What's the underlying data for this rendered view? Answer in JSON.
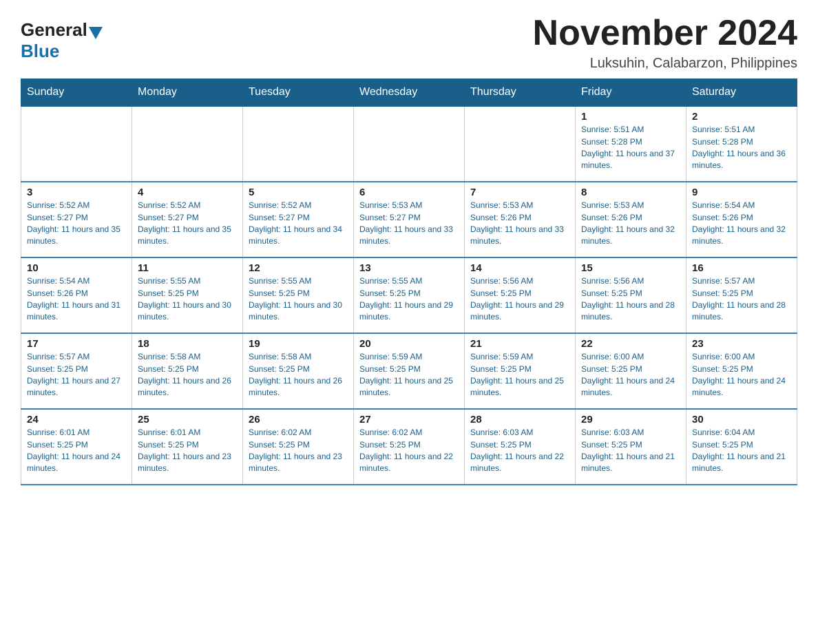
{
  "logo": {
    "general": "General",
    "blue": "Blue"
  },
  "title": {
    "month_year": "November 2024",
    "location": "Luksuhin, Calabarzon, Philippines"
  },
  "weekdays": [
    "Sunday",
    "Monday",
    "Tuesday",
    "Wednesday",
    "Thursday",
    "Friday",
    "Saturday"
  ],
  "weeks": [
    [
      {
        "day": "",
        "info": ""
      },
      {
        "day": "",
        "info": ""
      },
      {
        "day": "",
        "info": ""
      },
      {
        "day": "",
        "info": ""
      },
      {
        "day": "",
        "info": ""
      },
      {
        "day": "1",
        "info": "Sunrise: 5:51 AM\nSunset: 5:28 PM\nDaylight: 11 hours and 37 minutes."
      },
      {
        "day": "2",
        "info": "Sunrise: 5:51 AM\nSunset: 5:28 PM\nDaylight: 11 hours and 36 minutes."
      }
    ],
    [
      {
        "day": "3",
        "info": "Sunrise: 5:52 AM\nSunset: 5:27 PM\nDaylight: 11 hours and 35 minutes."
      },
      {
        "day": "4",
        "info": "Sunrise: 5:52 AM\nSunset: 5:27 PM\nDaylight: 11 hours and 35 minutes."
      },
      {
        "day": "5",
        "info": "Sunrise: 5:52 AM\nSunset: 5:27 PM\nDaylight: 11 hours and 34 minutes."
      },
      {
        "day": "6",
        "info": "Sunrise: 5:53 AM\nSunset: 5:27 PM\nDaylight: 11 hours and 33 minutes."
      },
      {
        "day": "7",
        "info": "Sunrise: 5:53 AM\nSunset: 5:26 PM\nDaylight: 11 hours and 33 minutes."
      },
      {
        "day": "8",
        "info": "Sunrise: 5:53 AM\nSunset: 5:26 PM\nDaylight: 11 hours and 32 minutes."
      },
      {
        "day": "9",
        "info": "Sunrise: 5:54 AM\nSunset: 5:26 PM\nDaylight: 11 hours and 32 minutes."
      }
    ],
    [
      {
        "day": "10",
        "info": "Sunrise: 5:54 AM\nSunset: 5:26 PM\nDaylight: 11 hours and 31 minutes."
      },
      {
        "day": "11",
        "info": "Sunrise: 5:55 AM\nSunset: 5:25 PM\nDaylight: 11 hours and 30 minutes."
      },
      {
        "day": "12",
        "info": "Sunrise: 5:55 AM\nSunset: 5:25 PM\nDaylight: 11 hours and 30 minutes."
      },
      {
        "day": "13",
        "info": "Sunrise: 5:55 AM\nSunset: 5:25 PM\nDaylight: 11 hours and 29 minutes."
      },
      {
        "day": "14",
        "info": "Sunrise: 5:56 AM\nSunset: 5:25 PM\nDaylight: 11 hours and 29 minutes."
      },
      {
        "day": "15",
        "info": "Sunrise: 5:56 AM\nSunset: 5:25 PM\nDaylight: 11 hours and 28 minutes."
      },
      {
        "day": "16",
        "info": "Sunrise: 5:57 AM\nSunset: 5:25 PM\nDaylight: 11 hours and 28 minutes."
      }
    ],
    [
      {
        "day": "17",
        "info": "Sunrise: 5:57 AM\nSunset: 5:25 PM\nDaylight: 11 hours and 27 minutes."
      },
      {
        "day": "18",
        "info": "Sunrise: 5:58 AM\nSunset: 5:25 PM\nDaylight: 11 hours and 26 minutes."
      },
      {
        "day": "19",
        "info": "Sunrise: 5:58 AM\nSunset: 5:25 PM\nDaylight: 11 hours and 26 minutes."
      },
      {
        "day": "20",
        "info": "Sunrise: 5:59 AM\nSunset: 5:25 PM\nDaylight: 11 hours and 25 minutes."
      },
      {
        "day": "21",
        "info": "Sunrise: 5:59 AM\nSunset: 5:25 PM\nDaylight: 11 hours and 25 minutes."
      },
      {
        "day": "22",
        "info": "Sunrise: 6:00 AM\nSunset: 5:25 PM\nDaylight: 11 hours and 24 minutes."
      },
      {
        "day": "23",
        "info": "Sunrise: 6:00 AM\nSunset: 5:25 PM\nDaylight: 11 hours and 24 minutes."
      }
    ],
    [
      {
        "day": "24",
        "info": "Sunrise: 6:01 AM\nSunset: 5:25 PM\nDaylight: 11 hours and 24 minutes."
      },
      {
        "day": "25",
        "info": "Sunrise: 6:01 AM\nSunset: 5:25 PM\nDaylight: 11 hours and 23 minutes."
      },
      {
        "day": "26",
        "info": "Sunrise: 6:02 AM\nSunset: 5:25 PM\nDaylight: 11 hours and 23 minutes."
      },
      {
        "day": "27",
        "info": "Sunrise: 6:02 AM\nSunset: 5:25 PM\nDaylight: 11 hours and 22 minutes."
      },
      {
        "day": "28",
        "info": "Sunrise: 6:03 AM\nSunset: 5:25 PM\nDaylight: 11 hours and 22 minutes."
      },
      {
        "day": "29",
        "info": "Sunrise: 6:03 AM\nSunset: 5:25 PM\nDaylight: 11 hours and 21 minutes."
      },
      {
        "day": "30",
        "info": "Sunrise: 6:04 AM\nSunset: 5:25 PM\nDaylight: 11 hours and 21 minutes."
      }
    ]
  ]
}
